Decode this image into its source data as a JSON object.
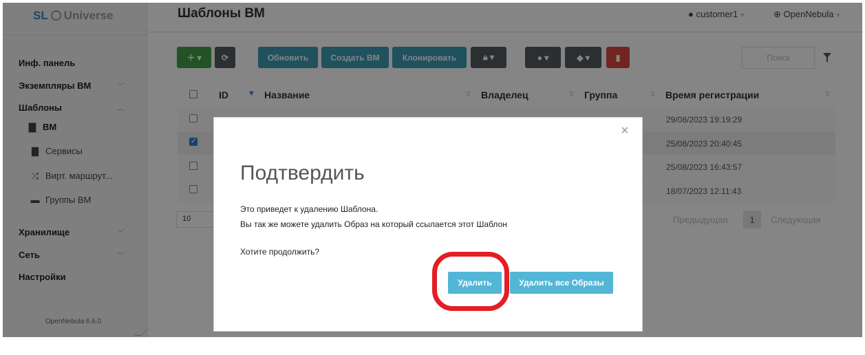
{
  "app": {
    "brand_sl": "SL",
    "brand_universe": "Universe",
    "version": "OpenNebula 6.6.0"
  },
  "sidebar": {
    "items": [
      {
        "label": "Инф. панель"
      },
      {
        "label": "Экземпляры ВМ"
      },
      {
        "label": "Шаблоны"
      },
      {
        "label": "ВМ"
      },
      {
        "label": "Сервисы"
      },
      {
        "label": "Вирт. маршрут..."
      },
      {
        "label": "Группы ВМ"
      },
      {
        "label": "Хранилище"
      },
      {
        "label": "Сеть"
      },
      {
        "label": "Настройки"
      }
    ]
  },
  "header": {
    "title": "Шаблоны ВМ",
    "user": "customer1",
    "zone": "OpenNebula"
  },
  "toolbar": {
    "refresh": "Обновить",
    "create_vm": "Создать ВМ",
    "clone": "Клонировать",
    "search_placeholder": "Поиск"
  },
  "table": {
    "columns": {
      "id": "ID",
      "name": "Название",
      "owner": "Владелец",
      "group": "Группа",
      "reg_time": "Время регистрации"
    },
    "rows": [
      {
        "checked": false,
        "time": "29/08/2023 19:19:29"
      },
      {
        "checked": true,
        "time": "25/08/2023 20:40:45"
      },
      {
        "checked": false,
        "time": "25/08/2023 16:43:57"
      },
      {
        "checked": false,
        "time": "18/07/2023 12:11:43"
      }
    ],
    "page_length": "10",
    "prev": "Предыдущая",
    "page": "1",
    "next": "Следующая"
  },
  "modal": {
    "title": "Подтвердить",
    "line1": "Это приведет к удалению Шаблона.",
    "line2": "Вы так же можете удалить Образ на который ссылается этот Шаблон",
    "question": "Хотите продолжить?",
    "delete_label": "Удалить",
    "delete_all_label": "Удалить все Образы",
    "close": "×"
  },
  "colors": {
    "highlight": "#e31e24",
    "modal_button": "#52b6d6",
    "brand": "#3a87c8"
  }
}
